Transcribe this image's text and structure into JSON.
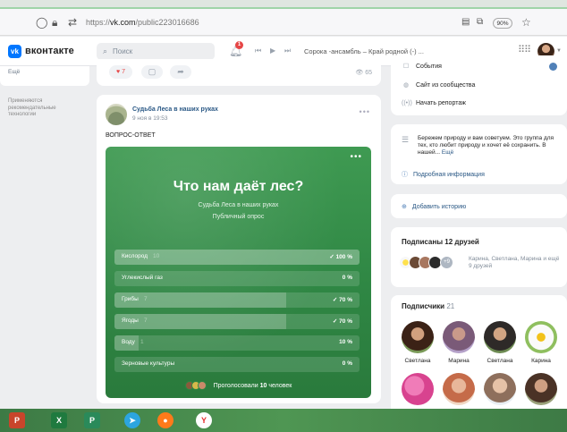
{
  "browser": {
    "url_prefix": "https://",
    "url_domain": "vk.com",
    "url_path": "/public223016686",
    "zoom": "90%"
  },
  "header": {
    "logo_letters": "vk",
    "brand": "вконтакте",
    "search_placeholder": "Поиск",
    "notification_count": "1",
    "track": "Сорока -ансамбль – Край родной (-) ..."
  },
  "left": {
    "more_label": "Ещё",
    "tech_note": "Применяются рекомендательные технологии"
  },
  "reactions": {
    "likes": "7",
    "views": "65"
  },
  "post": {
    "author": "Судьба Леса в наших руках",
    "date": "9 ноя в 19:53",
    "text": "ВОПРОС-ОТВЕТ"
  },
  "poll": {
    "question": "Что нам даёт лес?",
    "source": "Судьба Леса в наших руках",
    "type": "Публичный опрос",
    "options": [
      {
        "label": "Кислород",
        "count": "10",
        "percent": "✓ 100 %",
        "fraction": 1.0
      },
      {
        "label": "Углекислый газ",
        "count": "",
        "percent": "0 %",
        "fraction": 0.0
      },
      {
        "label": "Грибы",
        "count": "7",
        "percent": "✓ 70 %",
        "fraction": 0.7
      },
      {
        "label": "Ягоды",
        "count": "7",
        "percent": "✓ 70 %",
        "fraction": 0.7
      },
      {
        "label": "Воду",
        "count": "1",
        "percent": "10 %",
        "fraction": 0.1
      },
      {
        "label": "Зерновые культуры",
        "count": "",
        "percent": "0 %",
        "fraction": 0.0
      }
    ],
    "voters_prefix": "Проголосовали",
    "voters_count": "10",
    "voters_suffix": "человек"
  },
  "right": {
    "events": "События",
    "site": "Сайт из сообщества",
    "report": "Начать репортаж",
    "description": "Бережем природу и вам советуем. Это группа для тех, кто любит природу и хочет её сохранить. В нашей...",
    "desc_more": "Ещё",
    "more_info": "Подробная информация",
    "add_story": "Добавить историю",
    "friends_title": "Подписаны 12 друзей",
    "friends_plus": "+9",
    "friends_names": "Карина, Светлана, Марина и ещё 9 друзей",
    "subs_title": "Подписчики",
    "subs_count": "21",
    "subscribers": [
      "Светлана",
      "Марина",
      "Светлана",
      "Карина"
    ]
  },
  "colors": {
    "vk_blue": "#0077ff",
    "poll_green": "#2f8744",
    "link": "#2a5885",
    "taskbar": "#4f9653"
  }
}
